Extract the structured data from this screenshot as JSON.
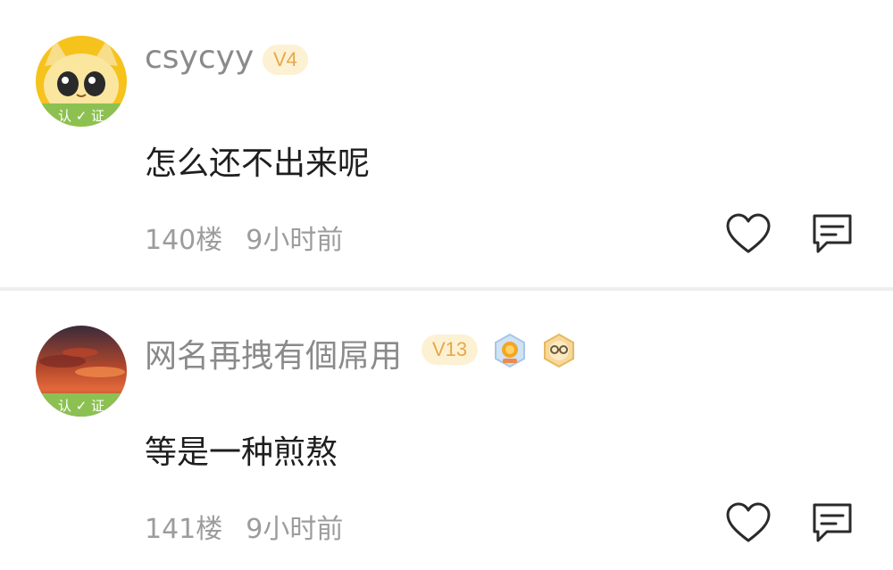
{
  "comments": [
    {
      "username": "csycyy",
      "level": "V4",
      "avatar_badge": "认证",
      "text": "怎么还不出来呢",
      "floor": "140楼",
      "time": "9小时前",
      "icons": {
        "like": "heart-icon",
        "reply": "comment-icon"
      }
    },
    {
      "username": "网名再拽有個屌用",
      "level": "V13",
      "avatar_badge": "认证",
      "medals": [
        "medal-icon",
        "medal-icon"
      ],
      "text": "等是一种煎熬",
      "floor": "141楼",
      "time": "9小时前",
      "icons": {
        "like": "heart-icon",
        "reply": "comment-icon"
      }
    }
  ],
  "colors": {
    "username": "#8a8a8a",
    "content": "#1e1e1e",
    "meta": "#9c9c9c",
    "badge_bg": "#fdf1d3",
    "badge_text": "#e7a84a",
    "divider": "#eeeeee",
    "verified_band": "#8cc152"
  }
}
